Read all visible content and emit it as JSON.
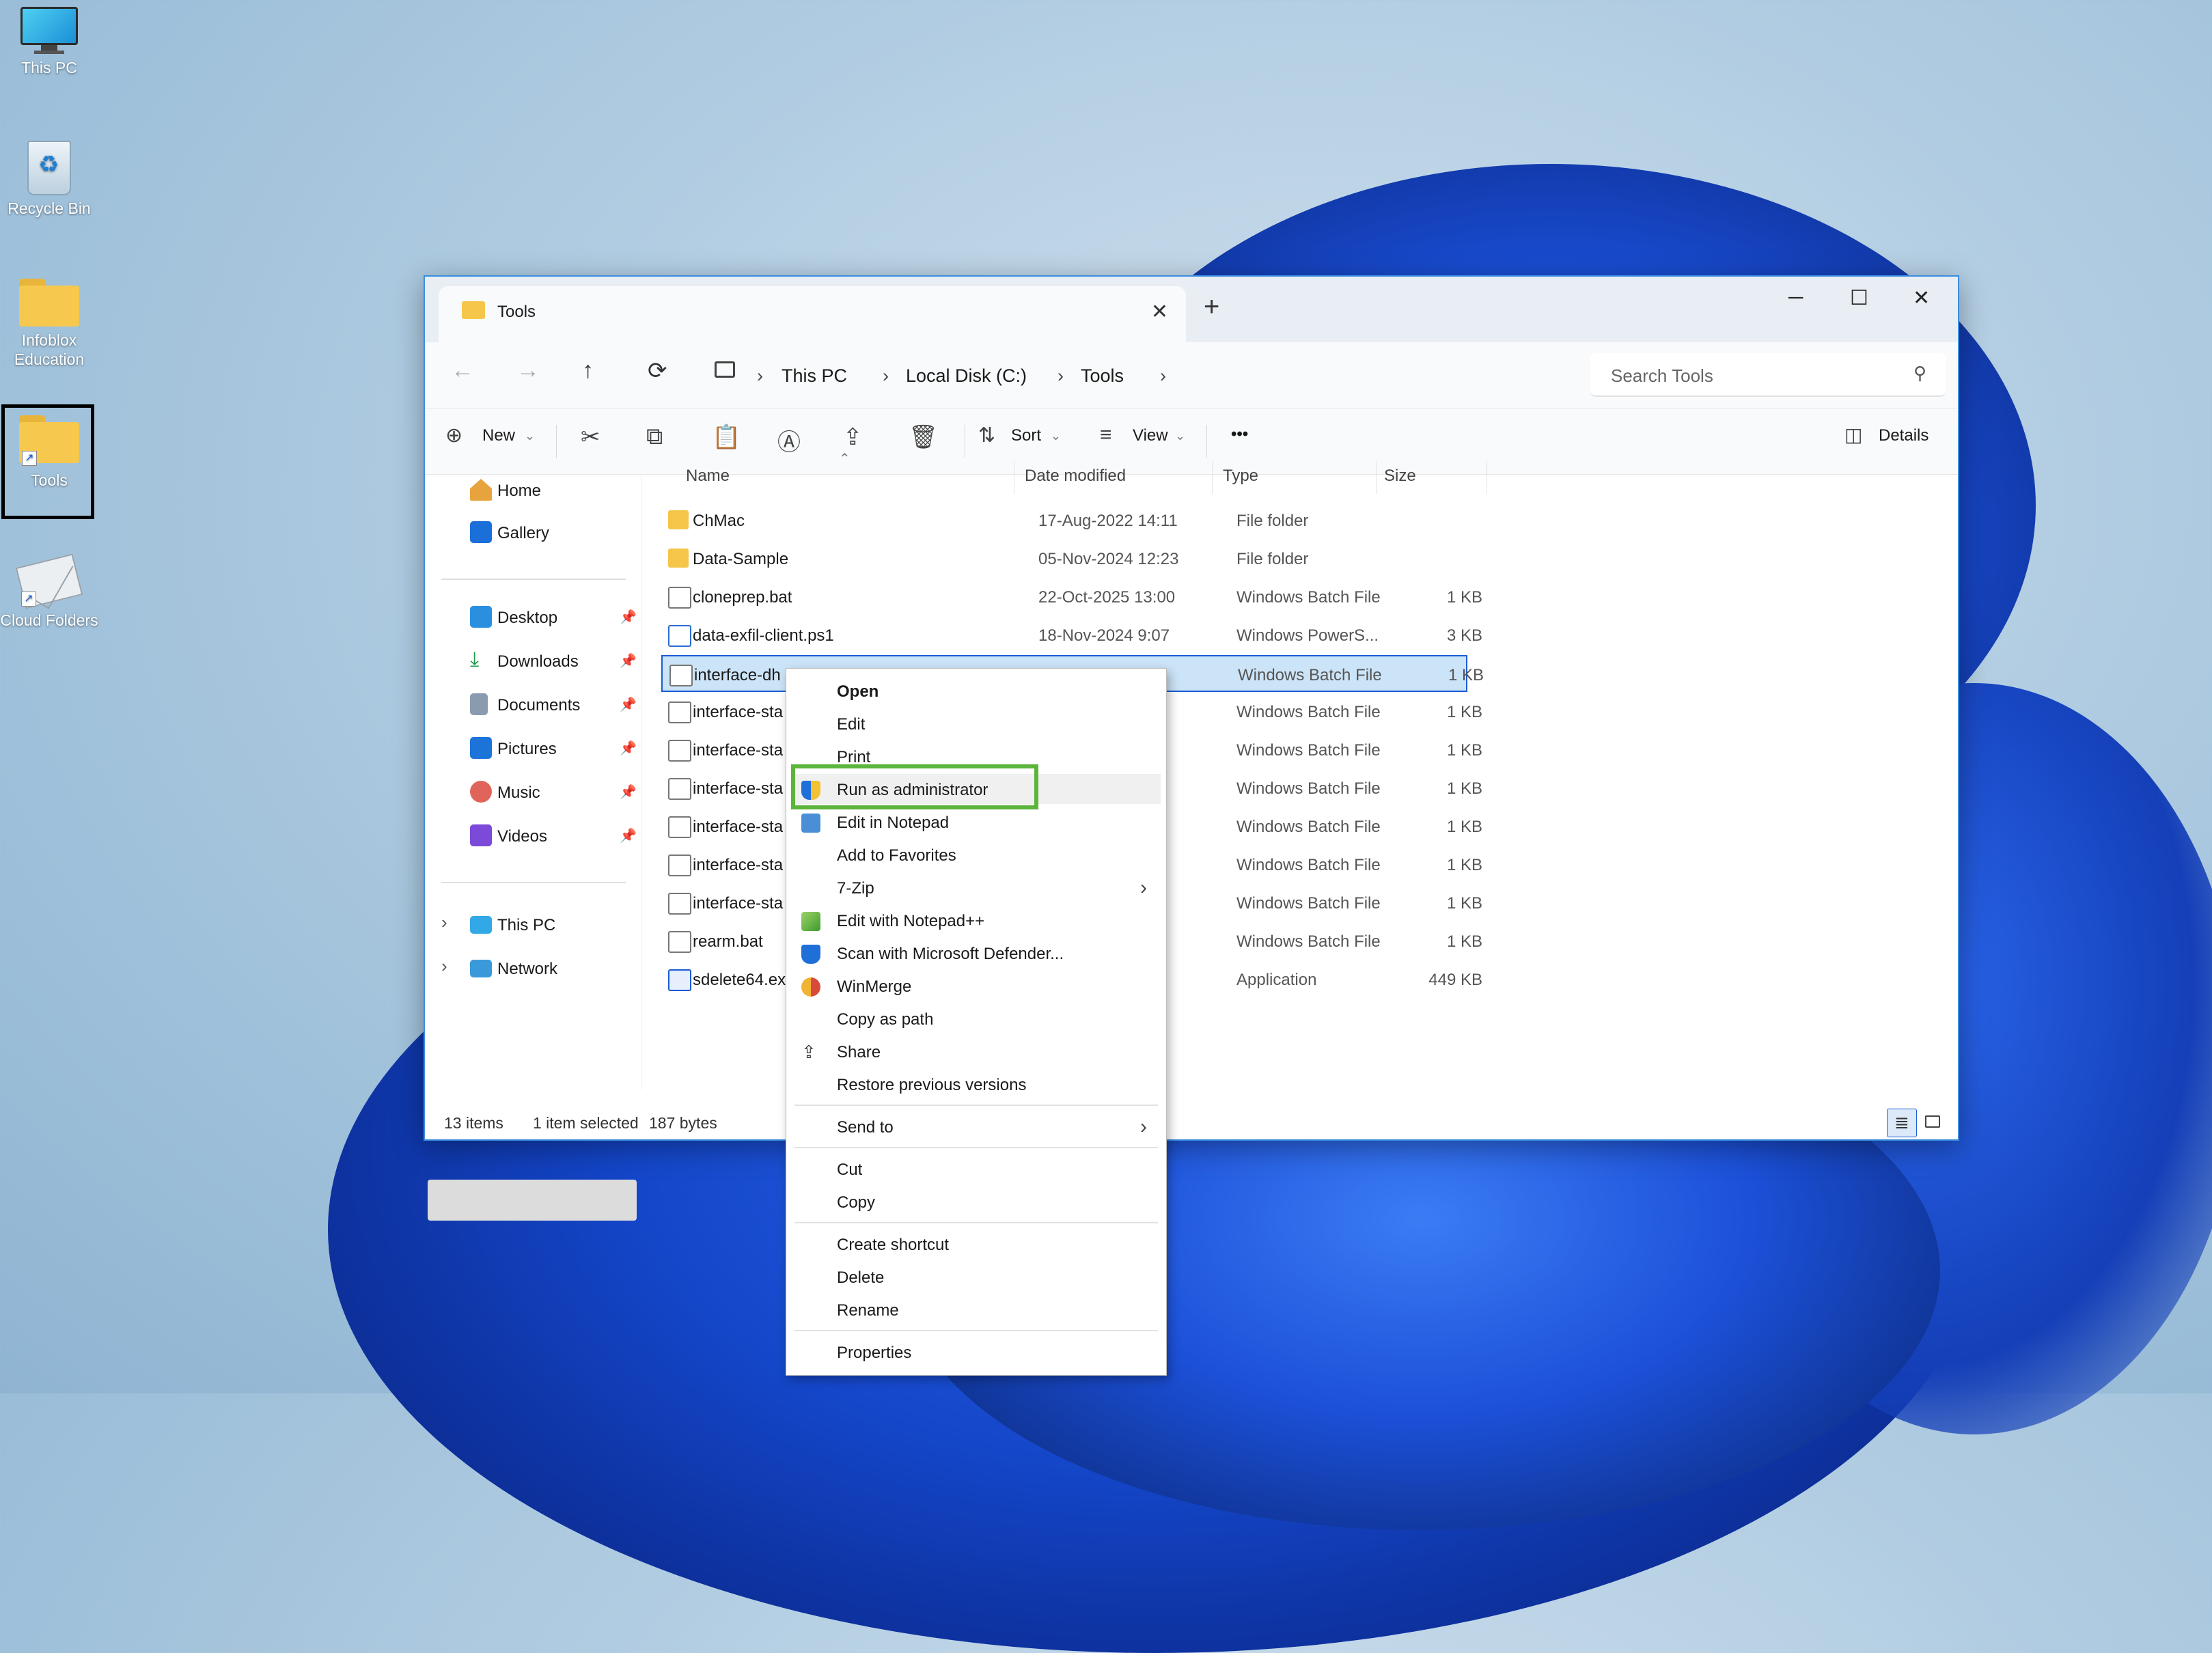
{
  "desktop": {
    "icons": [
      {
        "label": "This PC"
      },
      {
        "label": "Recycle Bin"
      },
      {
        "label": "Infoblox Education"
      },
      {
        "label": "Tools"
      },
      {
        "label": "Cloud Folders"
      }
    ]
  },
  "window": {
    "tab_title": "Tools",
    "tab_close": "✕",
    "new_tab": "+",
    "controls": {
      "minimize": "─",
      "maximize": "☐",
      "close": "✕"
    },
    "nav": {
      "back": "←",
      "forward": "→",
      "up": "↑",
      "refresh": "⟳"
    },
    "breadcrumb": [
      "This PC",
      "Local Disk (C:)",
      "Tools"
    ],
    "breadcrumb_sep": "›",
    "search_placeholder": "Search Tools",
    "toolbar": {
      "new": "New",
      "sort": "Sort",
      "view": "View",
      "more": "•••",
      "details": "Details"
    },
    "sidebar": {
      "top": [
        {
          "label": "Home"
        },
        {
          "label": "Gallery"
        }
      ],
      "pinned": [
        {
          "label": "Desktop"
        },
        {
          "label": "Downloads"
        },
        {
          "label": "Documents"
        },
        {
          "label": "Pictures"
        },
        {
          "label": "Music"
        },
        {
          "label": "Videos"
        }
      ],
      "drives": [
        {
          "label": "This PC"
        },
        {
          "label": "Network"
        }
      ]
    },
    "columns": {
      "name": "Name",
      "date": "Date modified",
      "type": "Type",
      "size": "Size"
    },
    "files": [
      {
        "name": "ChMac",
        "date": "17-Aug-2022 14:11",
        "type": "File folder",
        "size": ""
      },
      {
        "name": "Data-Sample",
        "date": "05-Nov-2024 12:23",
        "type": "File folder",
        "size": ""
      },
      {
        "name": "cloneprep.bat",
        "date": "22-Oct-2025 13:00",
        "type": "Windows Batch File",
        "size": "1 KB"
      },
      {
        "name": "data-exfil-client.ps1",
        "date": "18-Nov-2024 9:07",
        "type": "Windows PowerS...",
        "size": "3 KB"
      },
      {
        "name": "interface-dh",
        "date": "",
        "type": "Windows Batch File",
        "size": "1 KB"
      },
      {
        "name": "interface-sta",
        "date": "",
        "type": "Windows Batch File",
        "size": "1 KB"
      },
      {
        "name": "interface-sta",
        "date": "",
        "type": "Windows Batch File",
        "size": "1 KB"
      },
      {
        "name": "interface-sta",
        "date": "",
        "type": "Windows Batch File",
        "size": "1 KB"
      },
      {
        "name": "interface-sta",
        "date": "",
        "type": "Windows Batch File",
        "size": "1 KB"
      },
      {
        "name": "interface-sta",
        "date": "",
        "type": "Windows Batch File",
        "size": "1 KB"
      },
      {
        "name": "interface-sta",
        "date": "",
        "type": "Windows Batch File",
        "size": "1 KB"
      },
      {
        "name": "rearm.bat",
        "date": "",
        "type": "Windows Batch File",
        "size": "1 KB"
      },
      {
        "name": "sdelete64.exe",
        "date": "",
        "type": "Application",
        "size": "449 KB"
      }
    ],
    "status": {
      "count": "13 items",
      "selected": "1 item selected",
      "size": "187 bytes"
    }
  },
  "context_menu": {
    "open": "Open",
    "edit": "Edit",
    "print": "Print",
    "run_admin": "Run as administrator",
    "edit_notepad": "Edit in Notepad",
    "add_favorites": "Add to Favorites",
    "zip": "7-Zip",
    "notepadpp": "Edit with Notepad++",
    "defender": "Scan with Microsoft Defender...",
    "winmerge": "WinMerge",
    "copy_path": "Copy as path",
    "share": "Share",
    "restore": "Restore previous versions",
    "send_to": "Send to",
    "cut": "Cut",
    "copy": "Copy",
    "create_shortcut": "Create shortcut",
    "delete": "Delete",
    "rename": "Rename",
    "properties": "Properties",
    "submenu_arrow": "›"
  },
  "colors": {
    "accent": "#1a5bd7",
    "highlight_box": "#5cb53b",
    "selected_row": "#cce4f7",
    "folder": "#f5c64a"
  }
}
